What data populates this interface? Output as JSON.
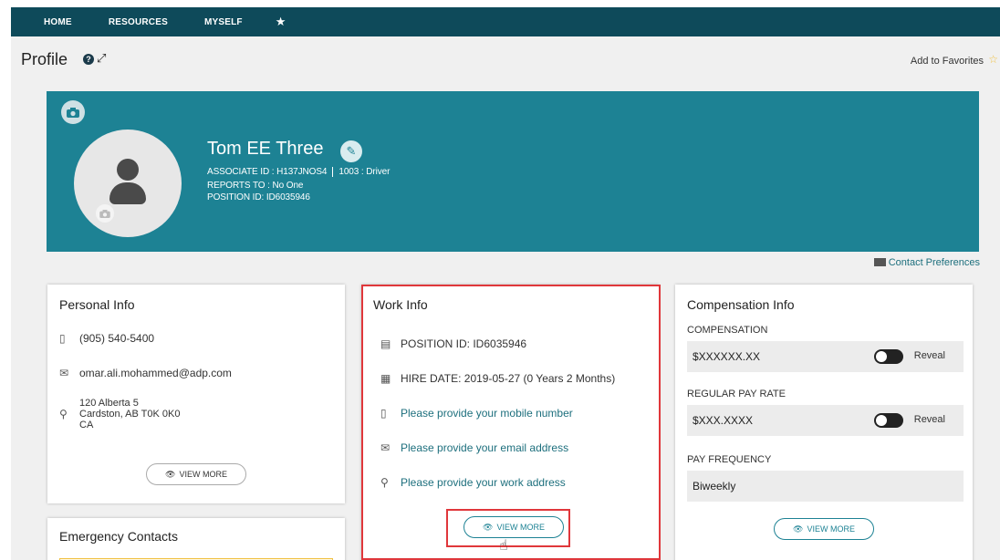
{
  "nav": {
    "items": [
      "HOME",
      "RESOURCES",
      "MYSELF"
    ],
    "star_icon": "star-icon"
  },
  "page": {
    "title": "Profile",
    "add_favorites": "Add to Favorites"
  },
  "employee": {
    "name": "Tom EE Three",
    "associate_id": "ASSOCIATE ID : H137JNOS4",
    "job": "1003 : Driver",
    "reports_to": "REPORTS TO : No One",
    "position_id": "POSITION ID: ID6035946"
  },
  "contact_preferences": "Contact Preferences",
  "personal_info": {
    "title": "Personal Info",
    "phone": "(905) 540-5400",
    "email": "omar.ali.mohammed@adp.com",
    "address_line1": "120 Alberta 5",
    "address_line2": "Cardston, AB T0K 0K0",
    "address_line3": "CA",
    "view_more": "VIEW MORE"
  },
  "work_info": {
    "title": "Work Info",
    "position_id": "POSITION ID: ID6035946",
    "hire_date": "HIRE DATE: 2019-05-27 (0 Years 2 Months)",
    "mobile_prompt": "Please provide your mobile number",
    "email_prompt": "Please provide your email address",
    "address_prompt": "Please provide your work address",
    "view_more": "VIEW MORE"
  },
  "compensation": {
    "title": "Compensation Info",
    "comp_label": "COMPENSATION",
    "comp_value": "$XXXXXX.XX",
    "pay_rate_label": "REGULAR PAY RATE",
    "pay_rate_value": "$XXX.XXXX",
    "frequency_label": "PAY FREQUENCY",
    "frequency_value": "Biweekly",
    "reveal": "Reveal",
    "view_more": "VIEW MORE"
  },
  "emergency_contacts": {
    "title": "Emergency Contacts"
  },
  "colors": {
    "nav_bg": "#0e4a5a",
    "banner": "#1d8294",
    "highlight": "#e0373b"
  }
}
